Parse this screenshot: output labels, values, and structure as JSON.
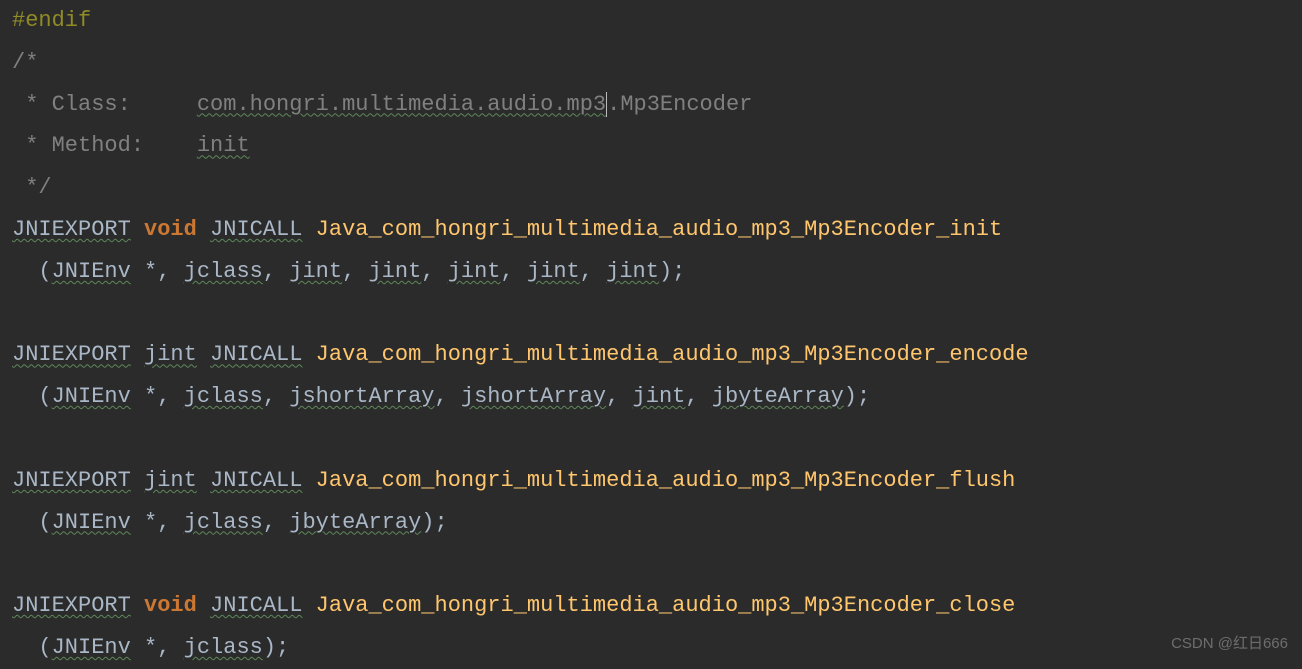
{
  "top_partial": "#endif",
  "comment_open": "/*",
  "comment_class_label": " * Class:     ",
  "comment_class_value": "com.hongri.multimedia.audio.mp3",
  "comment_class_suffix": ".Mp3Encoder",
  "comment_method_label": " * Method:    ",
  "comment_method_value": "init",
  "comment_close": " */",
  "kw_jniexport": "JNIEXPORT",
  "kw_jnicall": "JNICALL",
  "kw_void": "void",
  "t_jint": "jint",
  "t_jclass": "jclass",
  "t_jnienv": "JNIEnv",
  "t_jshortArray": "jshortArray",
  "t_jbyteArray": "jbyteArray",
  "fn_init": "Java_com_hongri_multimedia_audio_mp3_Mp3Encoder_init",
  "fn_encode": "Java_com_hongri_multimedia_audio_mp3_Mp3Encoder_encode",
  "fn_flush": "Java_com_hongri_multimedia_audio_mp3_Mp3Encoder_flush",
  "fn_close": "Java_com_hongri_multimedia_audio_mp3_Mp3Encoder_close",
  "sig_init": "  (JNIEnv *, jclass, jint, jint, jint, jint, jint);",
  "sig_encode": "  (JNIEnv *, jclass, jshortArray, jshortArray, jint, jbyteArray);",
  "sig_flush": "  (JNIEnv *, jclass, jbyteArray);",
  "sig_close": "  (JNIEnv *, jclass);",
  "watermark": "CSDN @红日666"
}
